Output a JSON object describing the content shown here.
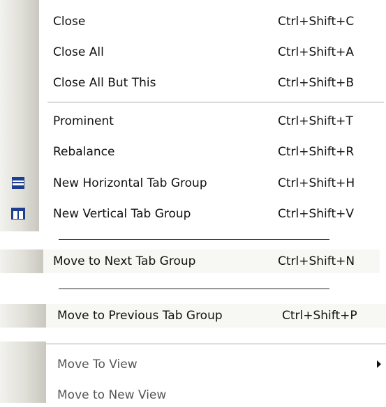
{
  "menu": {
    "group1": [
      {
        "label": "Close",
        "shortcut": "Ctrl+Shift+C"
      },
      {
        "label": "Close All",
        "shortcut": "Ctrl+Shift+A"
      },
      {
        "label": "Close All But This",
        "shortcut": "Ctrl+Shift+B"
      }
    ],
    "group2": [
      {
        "label": "Prominent",
        "shortcut": "Ctrl+Shift+T"
      },
      {
        "label": "Rebalance",
        "shortcut": "Ctrl+Shift+R"
      },
      {
        "label": "New Horizontal Tab Group",
        "shortcut": "Ctrl+Shift+H",
        "icon": "horizontal-tab-group-icon"
      },
      {
        "label": "New Vertical Tab Group",
        "shortcut": "Ctrl+Shift+V",
        "icon": "vertical-tab-group-icon"
      }
    ],
    "move_next": {
      "label": "Move to Next Tab Group",
      "shortcut": "Ctrl+Shift+N"
    },
    "move_prev": {
      "label": "Move to Previous Tab Group",
      "shortcut": "Ctrl+Shift+P"
    },
    "group4": [
      {
        "label": "Move To View",
        "submenu": true,
        "icon": "submenu-arrow-icon"
      },
      {
        "label": "Move to New View"
      }
    ]
  },
  "colors": {
    "icon_blue": "#1e3f8f",
    "separator": "#a9a9a9"
  }
}
